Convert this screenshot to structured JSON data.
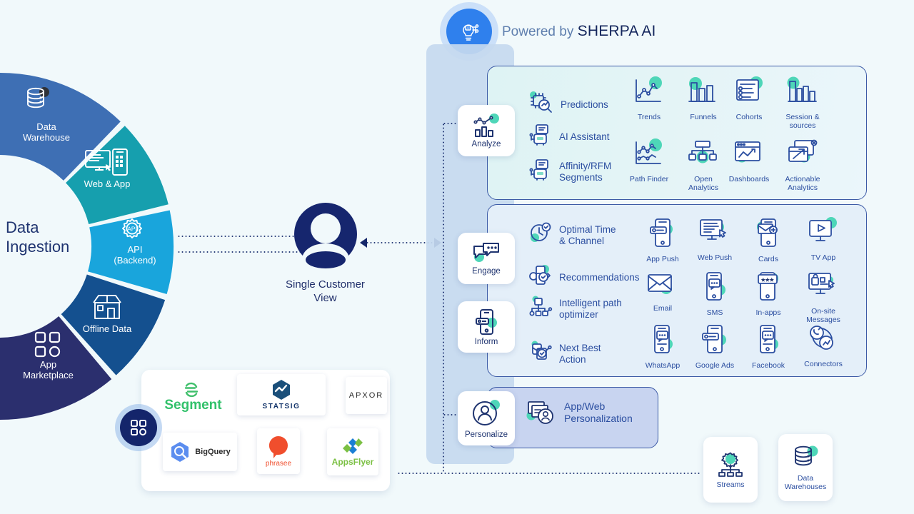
{
  "header": {
    "powered_by": "Powered by",
    "brand": "SHERPA AI",
    "badge_icon": "ai-lightbulb-icon"
  },
  "ingestion": {
    "title": "Data\nIngestion",
    "segments": [
      {
        "label": "Data\nWarehouse",
        "color": "#3e6fb4",
        "icon": "database-icon"
      },
      {
        "label": "Web & App",
        "color": "#169fae",
        "icon": "web-app-icon"
      },
      {
        "label": "API\n(Backend)",
        "color": "#19a5dc",
        "icon": "api-gear-icon"
      },
      {
        "label": "Offline Data",
        "color": "#14508f",
        "icon": "store-icon"
      },
      {
        "label": "App\nMarketplace",
        "color": "#2b2f6e",
        "icon": "app-grid-icon"
      }
    ]
  },
  "single_customer_view": {
    "label": "Single\nCustomer View",
    "icon": "person-avatar-icon"
  },
  "stages": [
    {
      "key": "analyze",
      "label": "Analyze",
      "icon": "analytics-chart-icon"
    },
    {
      "key": "engage",
      "label": "Engage",
      "icon": "chat-bubbles-icon"
    },
    {
      "key": "inform",
      "label": "Inform",
      "icon": "mobile-push-icon"
    },
    {
      "key": "personalize",
      "label": "Personalize",
      "icon": "user-circle-icon"
    }
  ],
  "analyze_panel": {
    "features": [
      {
        "label": "Predictions",
        "icon": "chip-search-icon"
      },
      {
        "label": "AI Assistant",
        "icon": "robot-icon"
      },
      {
        "label": "Affinity/RFM\nSegments",
        "icon": "robot-icon"
      }
    ],
    "tiles": [
      {
        "label": "Trends",
        "icon": "line-chart-icon"
      },
      {
        "label": "Funnels",
        "icon": "bar-chart-icon"
      },
      {
        "label": "Cohorts",
        "icon": "list-report-icon"
      },
      {
        "label": "Session &\nsources",
        "icon": "histogram-icon"
      },
      {
        "label": "Path Finder",
        "icon": "path-chart-icon"
      },
      {
        "label": "Open\nAnalytics",
        "icon": "hierarchy-icon"
      },
      {
        "label": "Dashboards",
        "icon": "browser-chart-icon"
      },
      {
        "label": "Actionable\nAnalytics",
        "icon": "window-arrow-icon"
      }
    ]
  },
  "engage_panel": {
    "features": [
      {
        "label": "Optimal Time\n& Channel",
        "icon": "clock-check-icon"
      },
      {
        "label": "Recommendations",
        "icon": "recommend-icon"
      },
      {
        "label": "Intelligent path\noptimizer",
        "icon": "path-node-icon"
      },
      {
        "label": "Next Best\nAction",
        "icon": "next-action-icon"
      }
    ],
    "tiles": [
      {
        "label": "App Push",
        "icon": "app-push-icon"
      },
      {
        "label": "Web Push",
        "icon": "web-push-icon"
      },
      {
        "label": "Cards",
        "icon": "cards-icon"
      },
      {
        "label": "TV App",
        "icon": "tv-app-icon"
      },
      {
        "label": "Email",
        "icon": "envelope-icon"
      },
      {
        "label": "SMS",
        "icon": "sms-icon"
      },
      {
        "label": "In-apps",
        "icon": "in-apps-icon"
      },
      {
        "label": "On-site\nMessages",
        "icon": "onsite-messages-icon"
      },
      {
        "label": "WhatsApp",
        "icon": "whatsapp-icon"
      },
      {
        "label": "Google Ads",
        "icon": "google-ads-icon"
      },
      {
        "label": "Facebook",
        "icon": "facebook-icon"
      },
      {
        "label": "Connectors",
        "icon": "connectors-icon"
      }
    ]
  },
  "personalize_panel": {
    "item": {
      "label": "App/Web\nPersonalization",
      "icon": "app-web-personalization-icon"
    }
  },
  "partners": [
    {
      "name": "Segment",
      "logo": "segment-logo"
    },
    {
      "name": "STATSIG",
      "logo": "statsig-logo"
    },
    {
      "name": "APXOR",
      "logo": "apxor-logo"
    },
    {
      "name": "BigQuery",
      "logo": "bigquery-logo"
    },
    {
      "name": "phrasee",
      "logo": "phrasee-logo"
    },
    {
      "name": "AppsFlyer",
      "logo": "appsflyer-logo"
    }
  ],
  "outputs": [
    {
      "label": "Streams",
      "icon": "streams-icon"
    },
    {
      "label": "Data\nWarehouses",
      "icon": "database-icon"
    }
  ],
  "colors": {
    "background": "#f1f9fb",
    "accent_teal": "#4ed6b8",
    "navy": "#1f3470",
    "panel_border": "#3c5aa6",
    "brand_blue": "#2f80ed"
  }
}
